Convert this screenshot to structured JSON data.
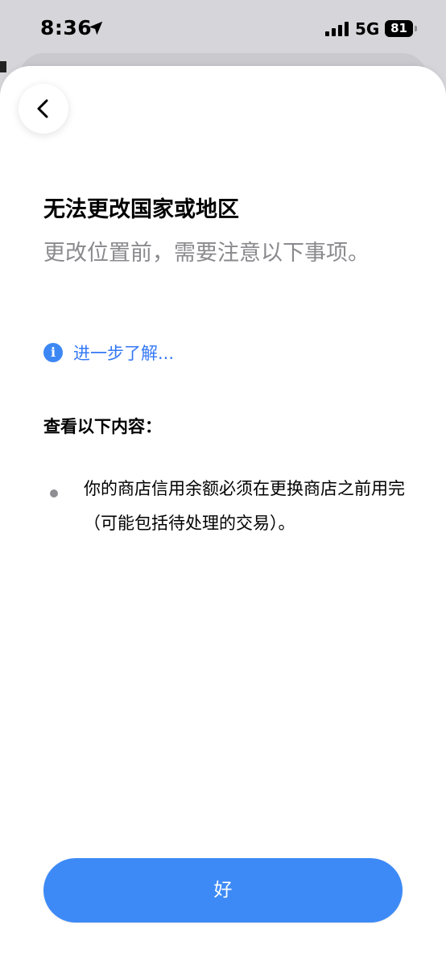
{
  "status_bar": {
    "time": "8:36",
    "network": "5G",
    "battery": "81"
  },
  "sheet": {
    "title": "无法更改国家或地区",
    "subtitle": "更改位置前，需要注意以下事项。",
    "learn_more": "进一步了解...",
    "info_glyph": "i",
    "section_heading": "查看以下内容：",
    "items": [
      "你的商店信用余额必须在更换商店之前用完（可能包括待处理的交易）。"
    ],
    "ok_label": "好"
  },
  "colors": {
    "accent": "#3d8af7",
    "link": "#3478f6",
    "secondary_text": "#8a8a8e"
  }
}
